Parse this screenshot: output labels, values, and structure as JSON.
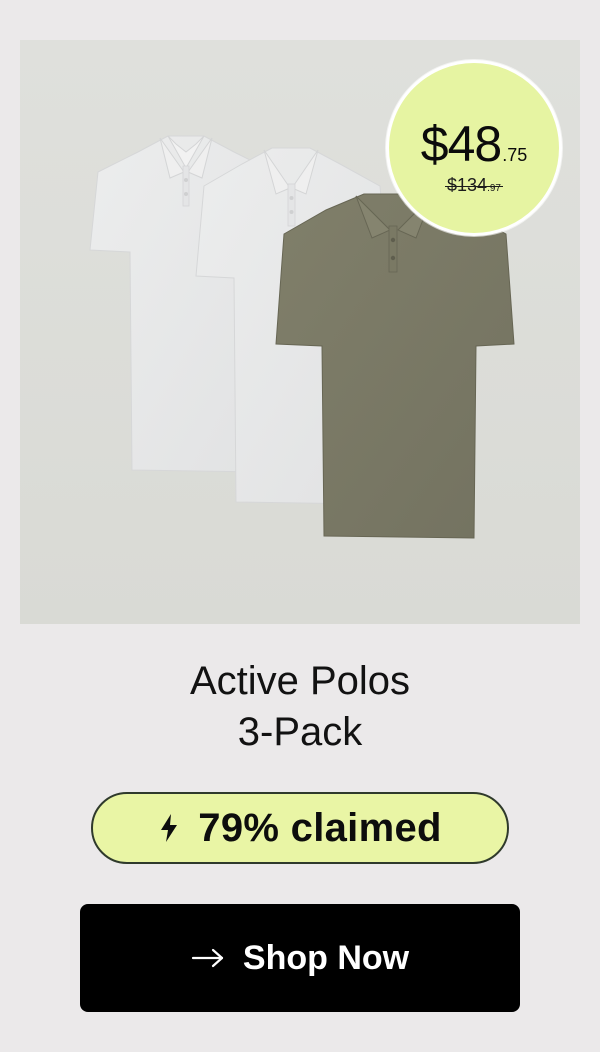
{
  "product": {
    "image_alt": "Active Polos 3-Pack product image",
    "title_line1": "Active Polos",
    "title_line2": "3-Pack"
  },
  "price": {
    "current_main": "$48",
    "current_cents": ".75",
    "original_main": "$134",
    "original_cents": ".97"
  },
  "claimed": {
    "icon": "lightning-bolt-icon",
    "label": "79% claimed",
    "percent": 79
  },
  "cta": {
    "icon": "arrow-right-icon",
    "label": "Shop Now"
  },
  "colors": {
    "background": "#ebe9ea",
    "badge_fill": "#e6f4a2",
    "pill_fill": "#e9f5a5",
    "pill_border": "#2f3a2c",
    "button": "#000000",
    "shirt_white": "#e8e9ea",
    "shirt_olive": "#7d7d66"
  }
}
